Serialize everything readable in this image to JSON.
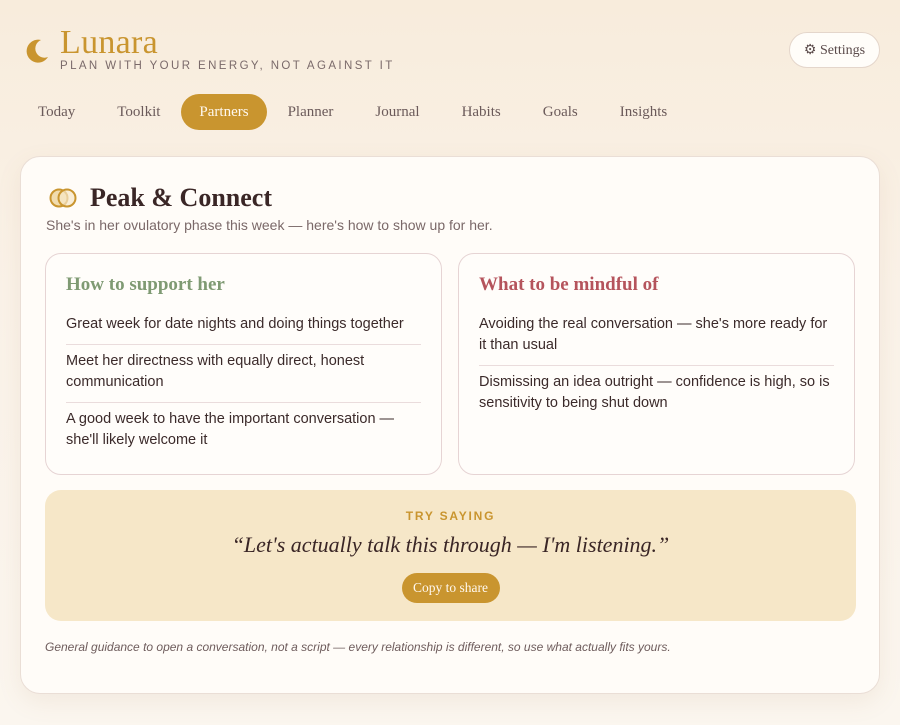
{
  "app": {
    "name": "Lunara",
    "tagline": "Plan with your energy, not against it"
  },
  "header": {
    "settings_label": "⚙ Settings"
  },
  "tabs": [
    {
      "label": "Today",
      "active": false
    },
    {
      "label": "Toolkit",
      "active": false
    },
    {
      "label": "Partners",
      "active": true
    },
    {
      "label": "Planner",
      "active": false
    },
    {
      "label": "Journal",
      "active": false
    },
    {
      "label": "Habits",
      "active": false
    },
    {
      "label": "Goals",
      "active": false
    },
    {
      "label": "Insights",
      "active": false
    }
  ],
  "card": {
    "title": "Peak & Connect",
    "subtitle": "She's in her ovulatory phase this week — here's how to show up for her.",
    "support": {
      "title": "How to support her",
      "items": [
        "Great week for date nights and doing things together",
        "Meet her directness with equally direct, honest communication",
        "A good week to have the important conversation — she'll likely welcome it"
      ]
    },
    "mindful": {
      "title": "What to be mindful of",
      "items": [
        "Avoiding the real conversation — she's more ready for it than usual",
        "Dismissing an idea outright — confidence is high, so is sensitivity to being shut down"
      ]
    },
    "try_saying": {
      "label": "TRY SAYING",
      "quote": "“Let's actually talk this through — I'm listening.”",
      "copy_label": "Copy to share"
    },
    "footnote": "General guidance to open a conversation, not a script — every relationship is different, so use what actually fits yours."
  },
  "colors": {
    "accent": "#c9952f",
    "support_title": "#7f9a73",
    "mindful_title": "#b5545c",
    "quote_bg": "#f6e7c8"
  },
  "icons": {
    "brand": "crescent-moon-icon",
    "section": "interlocking-rings-icon",
    "settings": "gear-icon"
  }
}
